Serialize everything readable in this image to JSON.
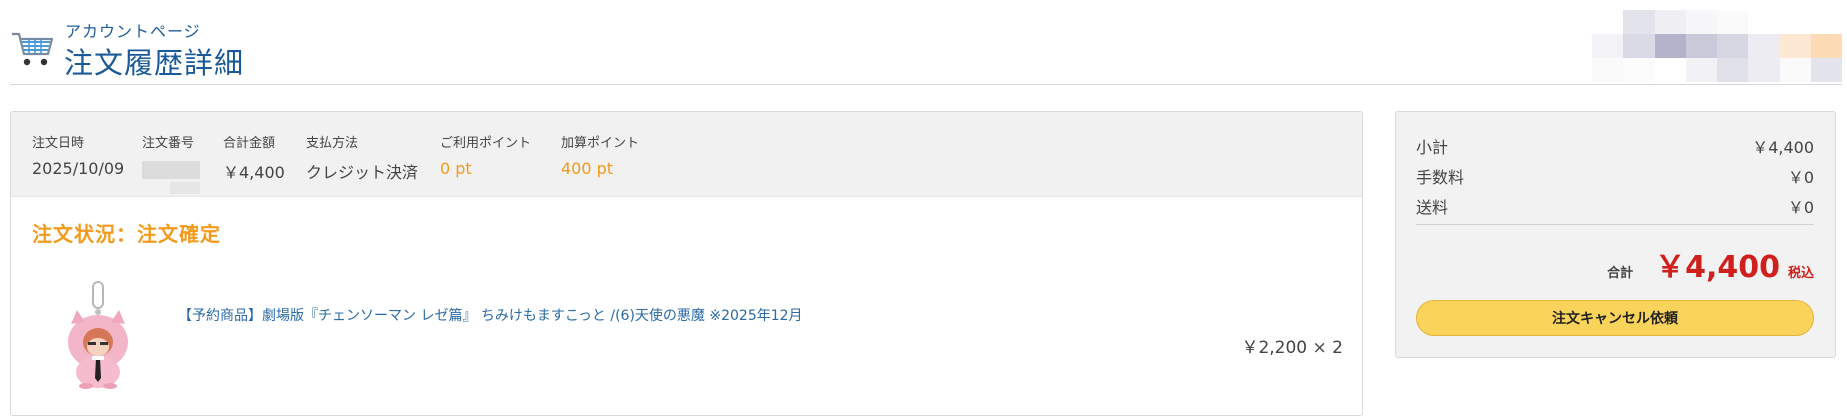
{
  "header": {
    "subtitle": "アカウントページ",
    "title": "注文履歴詳細",
    "cart_icon": "cart-icon"
  },
  "order": {
    "date_label": "注文日時",
    "date_value": "2025/10/09",
    "number_label": "注文番号",
    "total_label": "合計金額",
    "total_value": "￥4,400",
    "payment_label": "支払方法",
    "payment_value": "クレジット決済",
    "points_used_label": "ご利用ポイント",
    "points_used_value": "0 pt",
    "points_earned_label": "加算ポイント",
    "points_earned_value": "400 pt",
    "status": "注文状況：注文確定",
    "item": {
      "name": "【予約商品】劇場版『チェンソーマン レゼ篇』 ちみけもますこっと /(6)天使の悪魔 ※2025年12月",
      "price_qty": "￥2,200 × 2"
    }
  },
  "summary": {
    "subtotal_label": "小計",
    "subtotal_value": "￥4,400",
    "fee_label": "手数料",
    "fee_value": "￥0",
    "shipping_label": "送料",
    "shipping_value": "￥0",
    "total_label": "合計",
    "total_value": "￥4,400",
    "tax_label": "税込",
    "cancel_button": "注文キャンセル依頼"
  },
  "colors": {
    "accent_orange": "#f39a1d",
    "link_blue": "#2a6aa8",
    "total_red": "#d0201d",
    "button_yellow": "#fad35a"
  }
}
